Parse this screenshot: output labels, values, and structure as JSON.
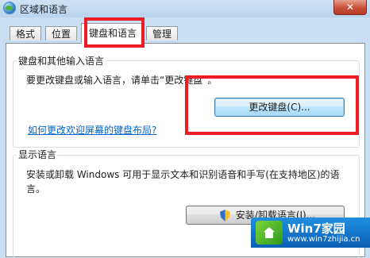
{
  "window": {
    "title": "区域和语言",
    "close_label": "✕"
  },
  "tabs": [
    {
      "label": "格式"
    },
    {
      "label": "位置"
    },
    {
      "label": "键盘和语言"
    },
    {
      "label": "管理"
    }
  ],
  "keyboards_group": {
    "legend": "键盘和其他输入语言",
    "description": "要更改键盘或输入语言，请单击“更改键盘”。",
    "change_keyboards_button": "更改键盘(C)...",
    "help_link": "如何更改欢迎屏幕的键盘布局?"
  },
  "display_group": {
    "legend": "显示语言",
    "description_line1": "安装或卸载 Windows 可用于显示文本和识别语音和手写(在支持地区)的语",
    "description_line2": "言。",
    "install_button": "安装/卸载语言(I)..."
  },
  "watermark": {
    "brand": "Win7家园",
    "url": "www.win7zhijia.cn"
  }
}
